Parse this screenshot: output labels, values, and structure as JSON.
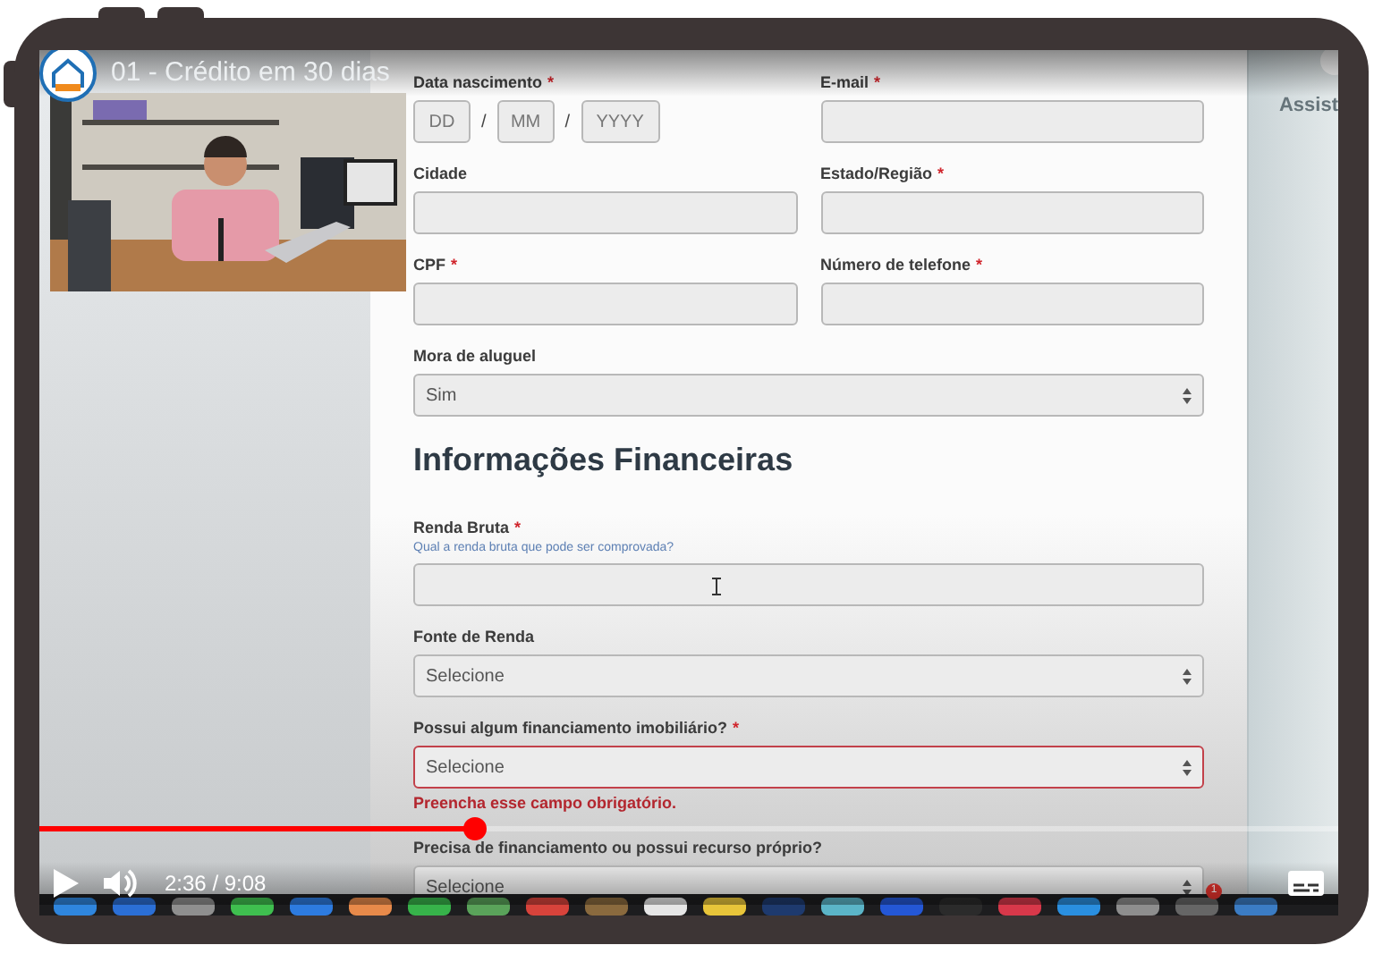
{
  "video": {
    "title": "01 - Crédito em 30 dias",
    "side_panel_text": "Assist"
  },
  "form": {
    "required_mark": "*",
    "rows": [
      {
        "kind": "pair",
        "fields": [
          {
            "kind": "date",
            "label": "Data nascimento",
            "required": true,
            "parts": [
              {
                "placeholder": "DD"
              },
              {
                "placeholder": "MM"
              },
              {
                "placeholder": "YYYY"
              }
            ],
            "separator": "/"
          },
          {
            "kind": "text",
            "label": "E-mail",
            "required": true
          }
        ]
      },
      {
        "kind": "pair",
        "fields": [
          {
            "kind": "text",
            "label": "Cidade",
            "required": false
          },
          {
            "kind": "text",
            "label": "Estado/Região",
            "required": true
          }
        ]
      },
      {
        "kind": "pair",
        "fields": [
          {
            "kind": "text",
            "label": "CPF",
            "required": true
          },
          {
            "kind": "text",
            "label": "Número de telefone",
            "required": true
          }
        ]
      },
      {
        "kind": "select",
        "label": "Mora de aluguel",
        "required": false,
        "value": "Sim"
      },
      {
        "kind": "heading",
        "text": "Informações Financeiras"
      },
      {
        "kind": "text",
        "label": "Renda Bruta",
        "required": true,
        "hint": "Qual a renda bruta que pode ser comprovada?"
      },
      {
        "kind": "select",
        "label": "Fonte de Renda",
        "required": false,
        "value": "Selecione"
      },
      {
        "kind": "select",
        "label": "Possui algum financiamento imobiliário?",
        "required": true,
        "value": "Selecione",
        "error": "Preencha esse campo obrigatório."
      },
      {
        "kind": "select",
        "label": "Precisa de financiamento ou possui recurso próprio?",
        "required": false,
        "value": "Selecione"
      }
    ]
  },
  "player": {
    "level": 0.335,
    "time": "2:36 / 9:08",
    "playing": false
  },
  "dock": {
    "badge": "1"
  }
}
